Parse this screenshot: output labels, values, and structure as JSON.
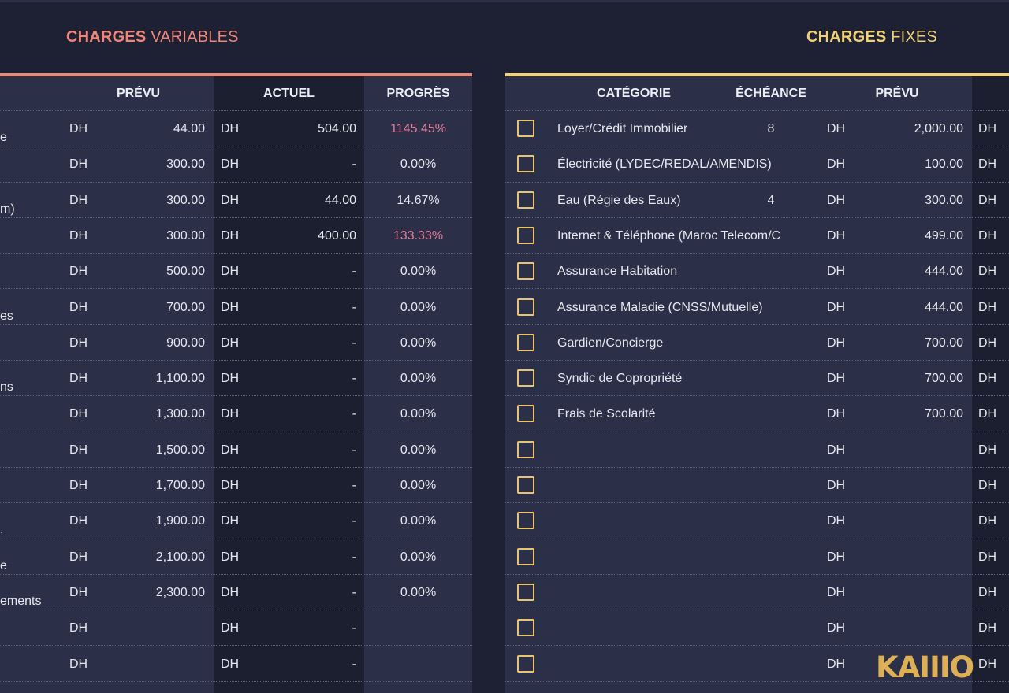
{
  "variable": {
    "title_bold": "CHARGES",
    "title_light": "VARIABLES",
    "headers": {
      "prevu": "PRÉVU",
      "actuel": "ACTUEL",
      "progres": "PROGRÈS"
    },
    "currency": "DH",
    "rows": [
      {
        "label": "e",
        "prevu": "44.00",
        "actuel": "504.00",
        "progress": "1145.45%",
        "over": true
      },
      {
        "label": "",
        "prevu": "300.00",
        "actuel": "-",
        "progress": "0.00%",
        "over": false
      },
      {
        "label": "m)",
        "prevu": "300.00",
        "actuel": "44.00",
        "progress": "14.67%",
        "over": false
      },
      {
        "label": "",
        "prevu": "300.00",
        "actuel": "400.00",
        "progress": "133.33%",
        "over": true
      },
      {
        "label": "",
        "prevu": "500.00",
        "actuel": "-",
        "progress": "0.00%",
        "over": false
      },
      {
        "label": "es",
        "prevu": "700.00",
        "actuel": "-",
        "progress": "0.00%",
        "over": false
      },
      {
        "label": "",
        "prevu": "900.00",
        "actuel": "-",
        "progress": "0.00%",
        "over": false
      },
      {
        "label": "ns",
        "prevu": "1,100.00",
        "actuel": "-",
        "progress": "0.00%",
        "over": false
      },
      {
        "label": "",
        "prevu": "1,300.00",
        "actuel": "-",
        "progress": "0.00%",
        "over": false
      },
      {
        "label": "",
        "prevu": "1,500.00",
        "actuel": "-",
        "progress": "0.00%",
        "over": false
      },
      {
        "label": "",
        "prevu": "1,700.00",
        "actuel": "-",
        "progress": "0.00%",
        "over": false
      },
      {
        "label": ".",
        "prevu": "1,900.00",
        "actuel": "-",
        "progress": "0.00%",
        "over": false
      },
      {
        "label": "e",
        "prevu": "2,100.00",
        "actuel": "-",
        "progress": "0.00%",
        "over": false
      },
      {
        "label": "ements",
        "prevu": "2,300.00",
        "actuel": "-",
        "progress": "0.00%",
        "over": false
      },
      {
        "label": "",
        "prevu": "",
        "actuel": "-",
        "progress": "",
        "over": false
      },
      {
        "label": "",
        "prevu": "",
        "actuel": "-",
        "progress": "",
        "over": false
      }
    ]
  },
  "fixed": {
    "title_bold": "CHARGES",
    "title_light": "FIXES",
    "headers": {
      "categorie": "CATÉGORIE",
      "echeance": "ÉCHÉANCE",
      "prevu": "PRÉVU"
    },
    "currency": "DH",
    "rows": [
      {
        "category": "Loyer/Crédit Immobilier",
        "echeance": "8",
        "prevu": "2,000.00"
      },
      {
        "category": "Électricité (LYDEC/REDAL/AMENDIS)",
        "echeance": "",
        "prevu": "100.00"
      },
      {
        "category": "Eau (Régie des Eaux)",
        "echeance": "4",
        "prevu": "300.00"
      },
      {
        "category": "Internet & Téléphone (Maroc Telecom/C",
        "echeance": "",
        "prevu": "499.00"
      },
      {
        "category": "Assurance Habitation",
        "echeance": "",
        "prevu": "444.00"
      },
      {
        "category": "Assurance Maladie (CNSS/Mutuelle)",
        "echeance": "",
        "prevu": "444.00"
      },
      {
        "category": "Gardien/Concierge",
        "echeance": "",
        "prevu": "700.00"
      },
      {
        "category": "Syndic de Copropriété",
        "echeance": "",
        "prevu": "700.00"
      },
      {
        "category": "Frais de Scolarité",
        "echeance": "",
        "prevu": "700.00"
      },
      {
        "category": "",
        "echeance": "",
        "prevu": ""
      },
      {
        "category": "",
        "echeance": "",
        "prevu": ""
      },
      {
        "category": "",
        "echeance": "",
        "prevu": ""
      },
      {
        "category": "",
        "echeance": "",
        "prevu": ""
      },
      {
        "category": "",
        "echeance": "",
        "prevu": ""
      },
      {
        "category": "",
        "echeance": "",
        "prevu": ""
      },
      {
        "category": "",
        "echeance": "",
        "prevu": ""
      }
    ]
  },
  "brand": {
    "logo_text": "KAIIIO"
  },
  "colors": {
    "variable_accent": "#f08677",
    "fixed_accent": "#f2d074",
    "over_budget": "#e17c9b",
    "checkbox": "#e7c46d"
  }
}
